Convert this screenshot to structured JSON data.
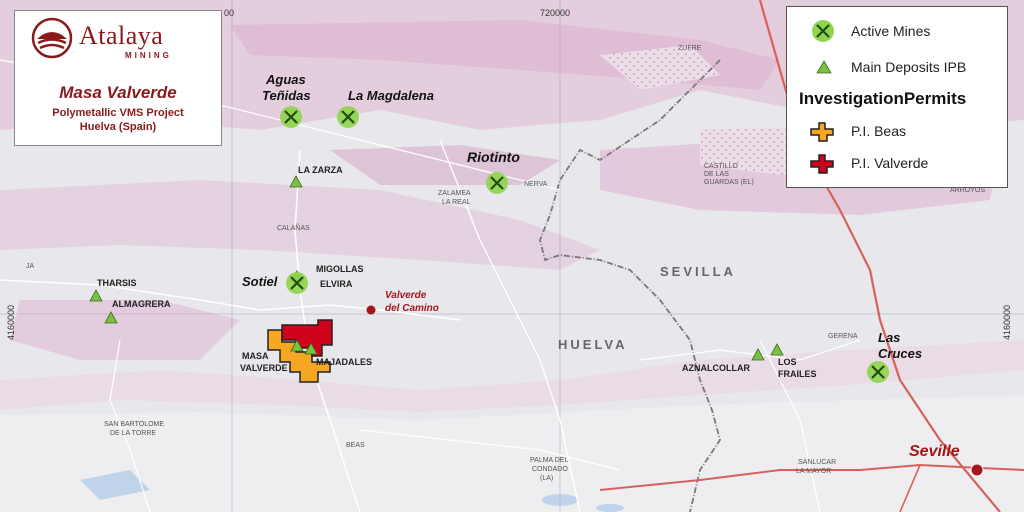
{
  "title_box": {
    "brand": "Atalaya",
    "brand_sub": "MINING",
    "project_name": "Masa Valverde",
    "project_desc_1": "Polymetallic VMS Project",
    "project_desc_2": "Huelva (Spain)"
  },
  "legend": {
    "active_mines": "Active Mines",
    "main_deposits": "Main Deposits IPB",
    "permits_heading": "InvestigationPermits",
    "pi_beas": "P.I. Beas",
    "pi_valverde": "P.I. Valverde"
  },
  "grid": {
    "x_label": "720000",
    "x_label_left": "00",
    "y_label_left": "4160000",
    "y_label_right": "4160000"
  },
  "mines": {
    "aguas_tenidas_1": "Aguas",
    "aguas_tenidas_2": "Teñidas",
    "la_magdalena": "La Magdalena",
    "riotinto": "Riotinto",
    "sotiel": "Sotiel",
    "las_cruces_1": "Las",
    "las_cruces_2": "Cruces"
  },
  "deposits": {
    "la_zarza": "LA ZARZA",
    "migollas": "MIGOLLAS",
    "elvira": "ELVIRA",
    "tharsis": "THARSIS",
    "almagrera": "ALMAGRERA",
    "masa_valverde_1": "MASA",
    "masa_valverde_2": "VALVERDE",
    "majadales": "MAJADALES",
    "aznalcollar": "AZNALCOLLAR",
    "los_frailes_1": "LOS",
    "los_frailes_2": "FRAILES"
  },
  "towns": {
    "valverde_1": "Valverde",
    "valverde_2": "del Camino",
    "seville": "Seville",
    "zalamea_1": "ZALAMEA",
    "zalamea_2": "LA REAL",
    "nerva": "NERVA",
    "calanas": "CALAÑAS",
    "castillo_1": "CASTILLO",
    "castillo_2": "DE LAS",
    "castillo_3": "GUARDAS (EL)",
    "zufre": "ZUFRE",
    "arroyos": "ARROYOS",
    "san_bartolome_1": "SAN BARTOLOME",
    "san_bartolome_2": "DE LA TORRE",
    "beas": "BEAS",
    "palma_1": "PALMA DEL",
    "palma_2": "CONDADO",
    "palma_3": "(LA)",
    "sanlucar_1": "SANLUCAR",
    "sanlucar_2": "LA MAYOR",
    "gerena": "GERENA",
    "ja": "JA"
  },
  "provinces": {
    "huelva": "HUELVA",
    "sevilla": "SEVILLA"
  },
  "colors": {
    "mine_green": "#8fd44a",
    "deposit_green": "#7ac143",
    "beas_orange": "#f5a623",
    "valverde_red": "#d0021b",
    "brand_red": "#8b1a1a",
    "geology_pink": "#e3c9dc",
    "base_gray": "#e9e9ec"
  }
}
